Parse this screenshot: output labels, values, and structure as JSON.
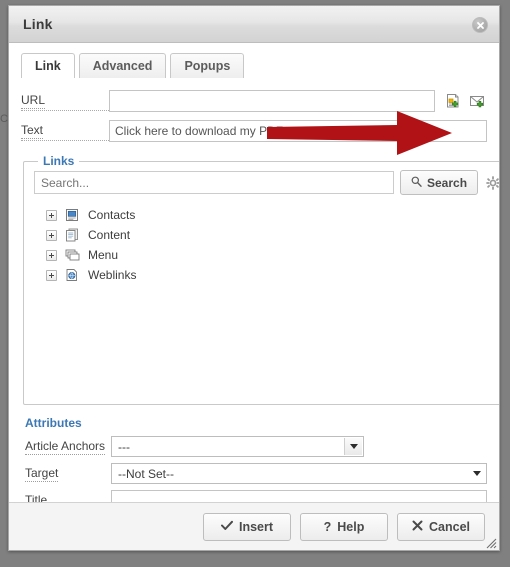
{
  "background": {
    "page_text": "C",
    "color": "#808080"
  },
  "dialog": {
    "title": "Link",
    "close_icon": "close-icon",
    "tabs": [
      {
        "label": "Link",
        "active": true
      },
      {
        "label": "Advanced",
        "active": false
      },
      {
        "label": "Popups",
        "active": false
      }
    ],
    "form": {
      "url_label": "URL",
      "url_value": "",
      "url_placeholder": "",
      "text_label": "Text",
      "text_value": "Click here to download my PDF",
      "icons": [
        {
          "name": "insert-document-link-icon"
        },
        {
          "name": "insert-email-link-icon"
        }
      ]
    },
    "links_panel": {
      "legend": "Links",
      "search_placeholder": "Search...",
      "search_value": "",
      "search_button": "Search",
      "search_icon": "magnifier-icon",
      "options_icon": "gear-icon",
      "tree": [
        {
          "label": "Contacts",
          "icon": "contacts-icon",
          "expander": "plus"
        },
        {
          "label": "Content",
          "icon": "content-pages-icon",
          "expander": "plus"
        },
        {
          "label": "Menu",
          "icon": "menu-stack-icon",
          "expander": "plus"
        },
        {
          "label": "Weblinks",
          "icon": "weblinks-globe-icon",
          "expander": "plus"
        }
      ]
    },
    "attributes": {
      "title": "Attributes",
      "article_anchors_label": "Article Anchors",
      "article_anchors_value": "---",
      "target_label": "Target",
      "target_value": "--Not Set--",
      "title_label": "Title",
      "title_value": ""
    },
    "footer": {
      "insert_label": "Insert",
      "insert_icon": "checkmark-icon",
      "help_label": "Help",
      "help_icon": "question-mark-icon",
      "cancel_label": "Cancel",
      "cancel_icon": "x-mark-icon",
      "resize_grip": "resize-grip-icon"
    }
  },
  "annotation": {
    "arrow_color": "#b01216",
    "arrow_direction": "right",
    "points_at": "insert-document-link-icon"
  }
}
